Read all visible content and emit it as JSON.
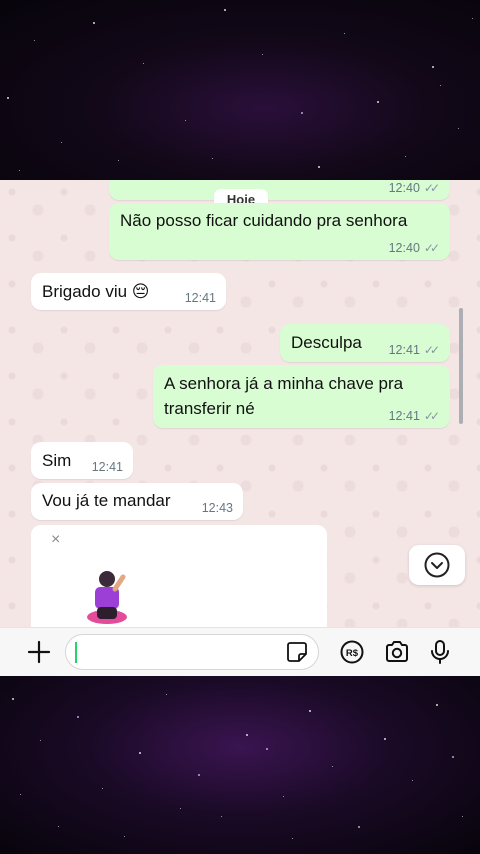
{
  "chat": {
    "date_label": "Hoje",
    "partial_top": {
      "time": "12:40",
      "ticks": "✓✓"
    },
    "messages": [
      {
        "dir": "out",
        "text": "Não posso ficar cuidando pra senhora",
        "time": "12:40",
        "ticks": "✓✓"
      },
      {
        "dir": "in",
        "text": "Brigado viu 😔",
        "time": "12:41"
      },
      {
        "dir": "out",
        "text": "Desculpa",
        "time": "12:41",
        "ticks": "✓✓"
      },
      {
        "dir": "out",
        "lines": [
          "A senhora já a minha chave pra",
          "transferir né"
        ],
        "time": "12:41",
        "ticks": "✓✓"
      },
      {
        "dir": "in",
        "text": "Sim",
        "time": "12:41"
      },
      {
        "dir": "in",
        "text": "Vou já te mandar",
        "time": "12:43"
      }
    ],
    "sticker_close": "×"
  },
  "input_bar": {
    "icons": [
      "plus-icon",
      "sticker-icon",
      "pix-icon",
      "camera-icon",
      "microphone-icon"
    ],
    "pix_label": "R$"
  },
  "colors": {
    "outgoing_bubble": "#d9fdd3",
    "incoming_bubble": "#ffffff",
    "wallpaper": "#f5e6e6",
    "caret": "#25d366"
  }
}
